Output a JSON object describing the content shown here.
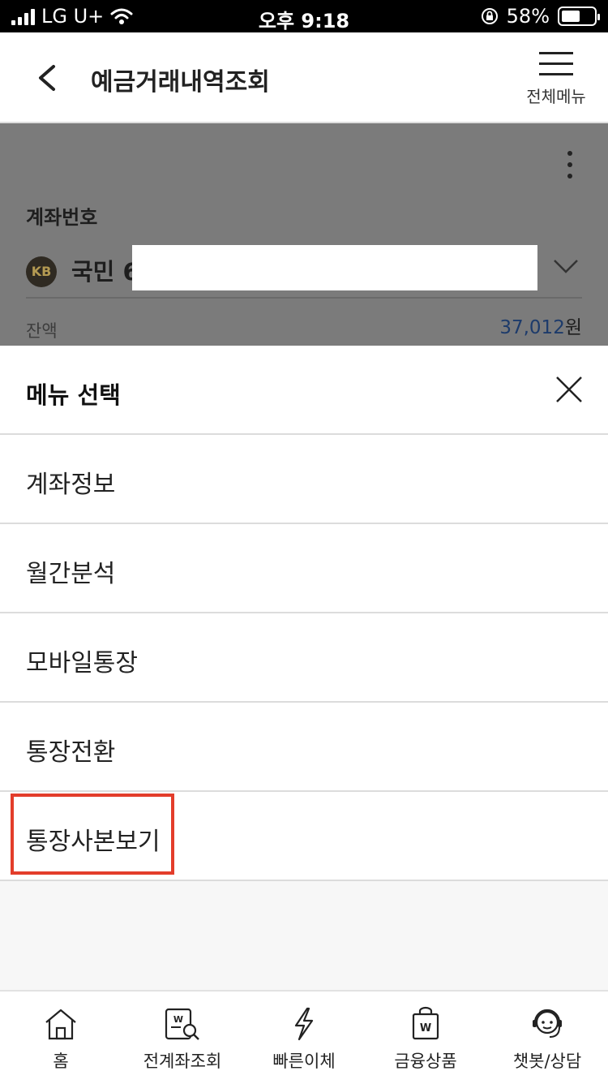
{
  "status_bar": {
    "carrier": "LG U+",
    "time": "오후 9:18",
    "battery": "58%",
    "battery_level": 0.58
  },
  "header": {
    "title": "예금거래내역조회",
    "menu_label": "전체메뉴"
  },
  "account": {
    "label": "계좌번호",
    "bank_logo_text": "KB",
    "bank_name": "국민 6",
    "balance_label": "잔액",
    "balance_value": "37,012",
    "balance_unit": "원"
  },
  "menu_sheet": {
    "title": "메뉴 선택",
    "items": [
      {
        "label": "계좌정보"
      },
      {
        "label": "월간분석"
      },
      {
        "label": "모바일통장"
      },
      {
        "label": "통장전환"
      },
      {
        "label": "통장사본보기"
      }
    ],
    "highlight_color": "#e33d2b"
  },
  "tabbar": {
    "items": [
      {
        "label": "홈",
        "icon": "home-icon"
      },
      {
        "label": "전계좌조회",
        "icon": "account-search-icon"
      },
      {
        "label": "빠른이체",
        "icon": "lightning-icon"
      },
      {
        "label": "금융상품",
        "icon": "shopping-bag-icon"
      },
      {
        "label": "챗봇/상담",
        "icon": "chatbot-icon"
      }
    ]
  }
}
